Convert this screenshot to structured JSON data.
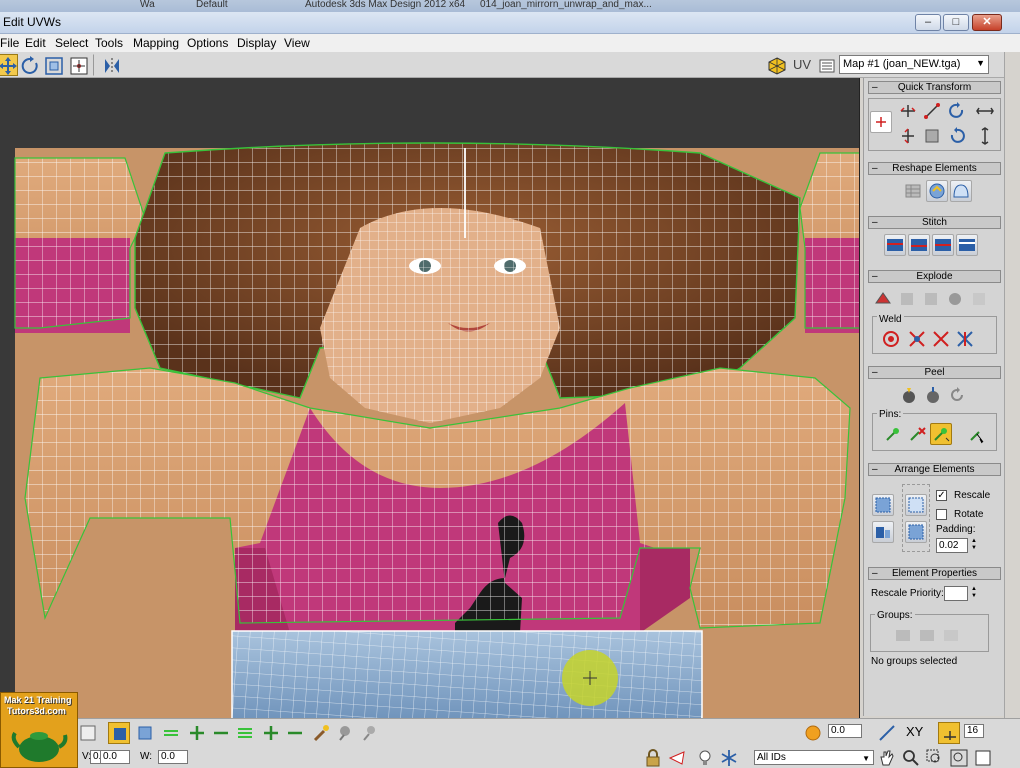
{
  "os_strip": {
    "left": "Wa",
    "mid": "Default",
    "app_title": "Autodesk 3ds Max Design 2012 x64",
    "file": "014_joan_mirrorn_unwrap_and_max..."
  },
  "window": {
    "title": "Edit UVWs"
  },
  "menu": [
    "File",
    "Edit",
    "Select",
    "Tools",
    "Mapping",
    "Options",
    "Display",
    "View"
  ],
  "toolbar": {
    "uv_label": "UV",
    "map_selected": "Map #1 (joan_NEW.tga)"
  },
  "panel": {
    "quick_transform": "Quick Transform",
    "reshape_elements": "Reshape Elements",
    "stitch": "Stitch",
    "explode": "Explode",
    "weld_label": "Weld",
    "peel": "Peel",
    "pins_label": "Pins:",
    "arrange_elements": "Arrange Elements",
    "rescale_label": "Rescale",
    "rescale_checked": true,
    "rotate_label": "Rotate",
    "rotate_checked": false,
    "padding_label": "Padding:",
    "padding_value": "0.02",
    "element_properties": "Element Properties",
    "rescale_priority_label": "Rescale Priority:",
    "rescale_priority_value": "",
    "groups_label": "Groups:",
    "no_groups": "No groups selected"
  },
  "bottom": {
    "u_value": "0.0",
    "v_label": "V:",
    "v_value": "0.0",
    "w_label": "W:",
    "w_value": "0.0",
    "softsel_value": "0.0",
    "xy_label": "XY",
    "grid_value": "16",
    "ids_value": "All IDs"
  },
  "watermark": {
    "line1": "Mak 21 Training",
    "line2": "Tutors3d.com"
  },
  "colors": {
    "viewport_bg": "#393939",
    "hair": "#7a4a2c",
    "skin": "#d49a6c",
    "shirt": "#c0387a",
    "jeans": "#8aa9c8",
    "border_seam": "#39c23a",
    "mesh_line": "#ffffff"
  }
}
